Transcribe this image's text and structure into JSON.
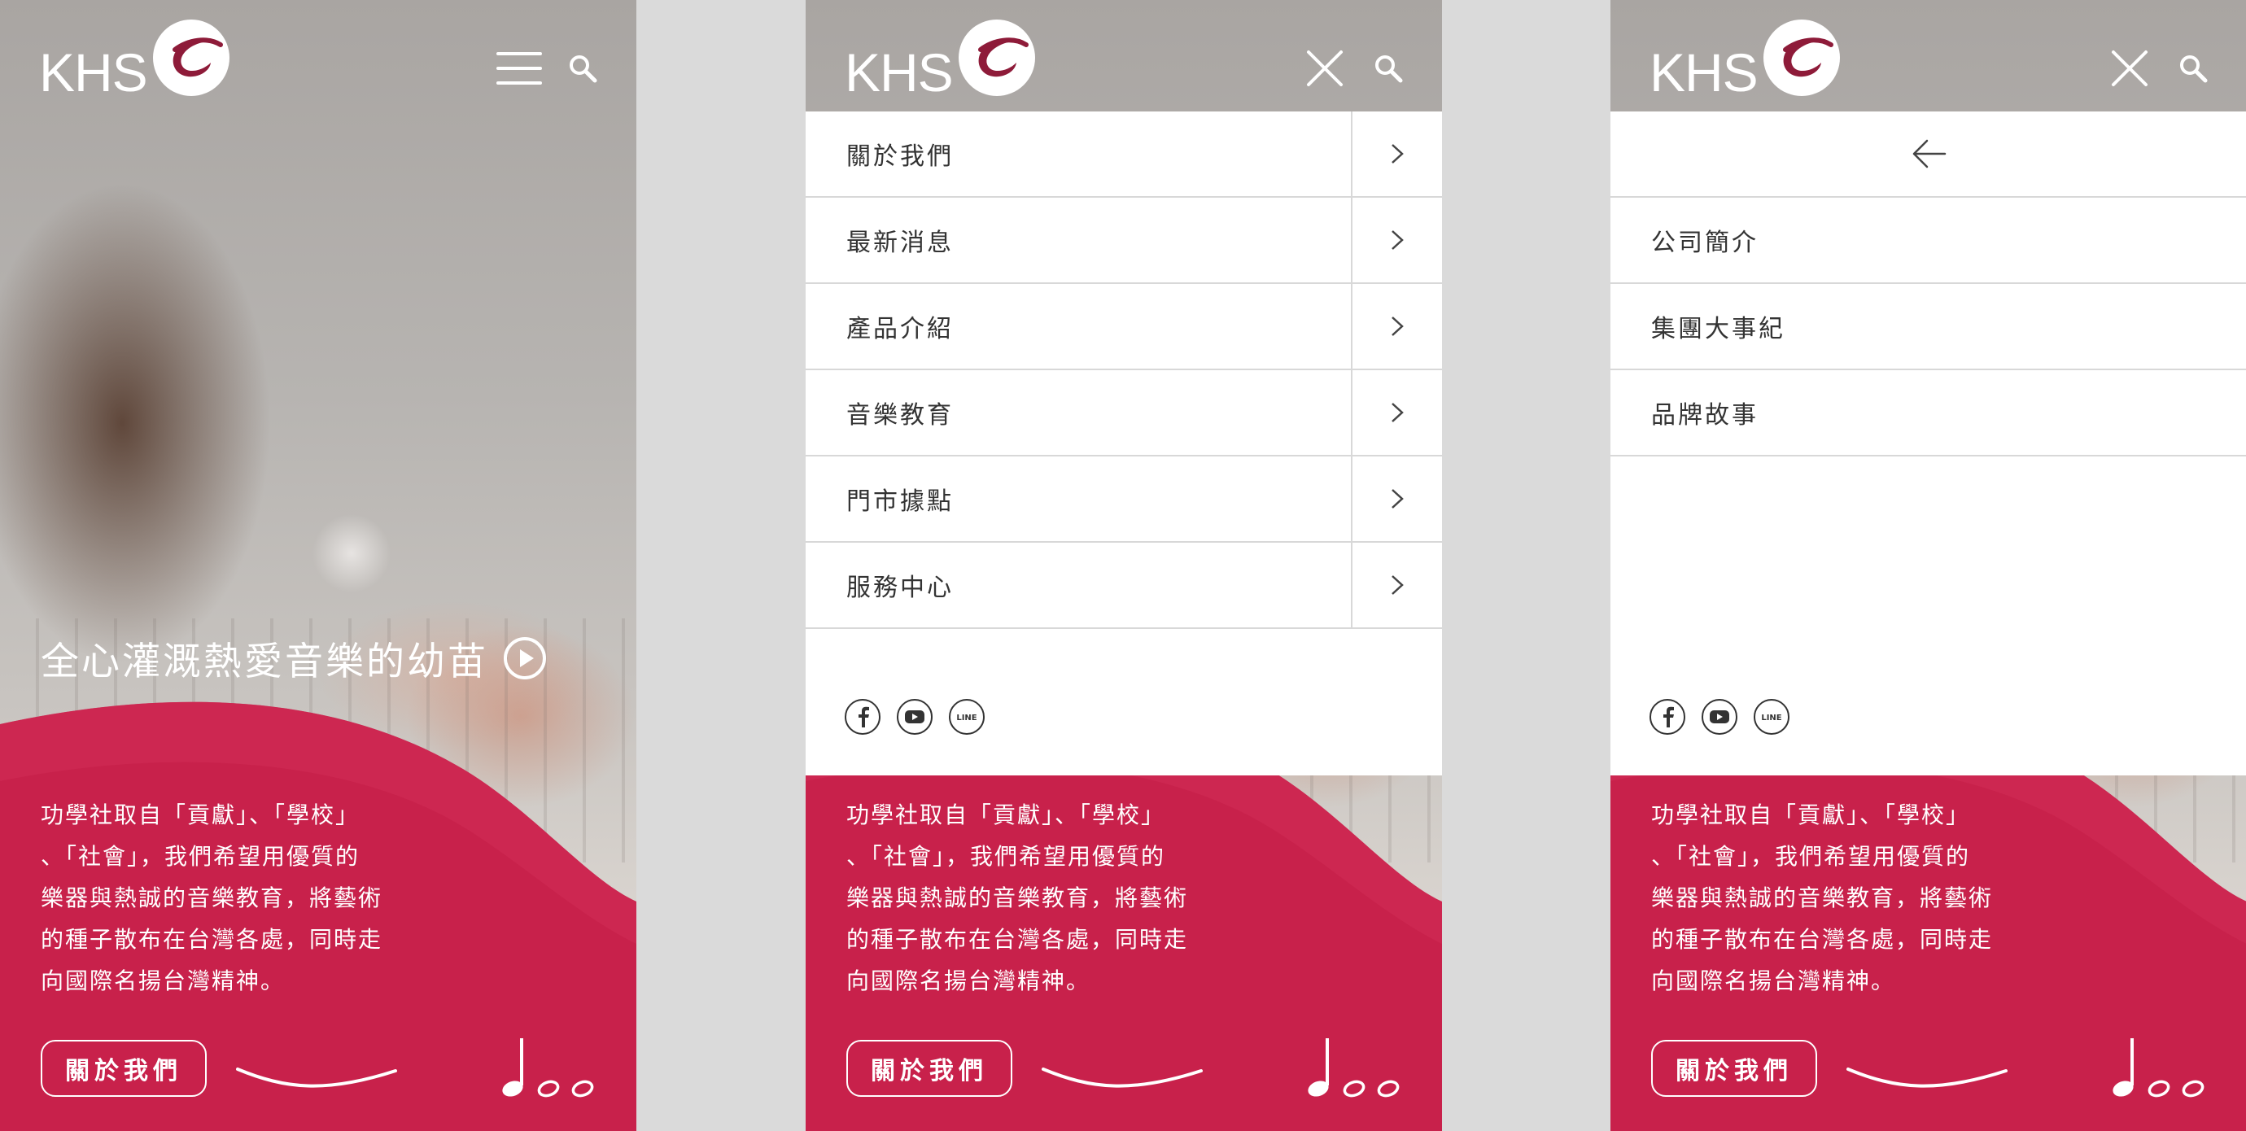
{
  "brand": {
    "name": "KHS"
  },
  "hero": {
    "tagline": "全心灌溉熱愛音樂的幼苗"
  },
  "intro": {
    "lines": [
      "功學社取自「貢獻」、「學校」",
      "、「社會」，我們希望用優質的",
      "樂器與熱誠的音樂教育，將藝術",
      "的種子散布在台灣各處，同時走",
      "向國際名揚台灣精神。"
    ],
    "button_label": "關於我們"
  },
  "nav": {
    "items": [
      "關於我們",
      "最新消息",
      "產品介紹",
      "音樂教育",
      "門市據點",
      "服務中心"
    ]
  },
  "submenu": {
    "items": [
      "公司簡介",
      "集團大事紀",
      "品牌故事"
    ]
  },
  "social": {
    "line_label": "LINE"
  },
  "colors": {
    "accent": "#c8214b",
    "accent_light": "#d12b55",
    "divider": "#d8d8d8",
    "menu_text": "#333333"
  },
  "icons": [
    "menu-icon",
    "close-icon",
    "search-icon",
    "play-icon",
    "chevron-right-icon",
    "arrow-left-icon",
    "facebook-icon",
    "youtube-icon",
    "line-icon",
    "music-notes-icon"
  ]
}
